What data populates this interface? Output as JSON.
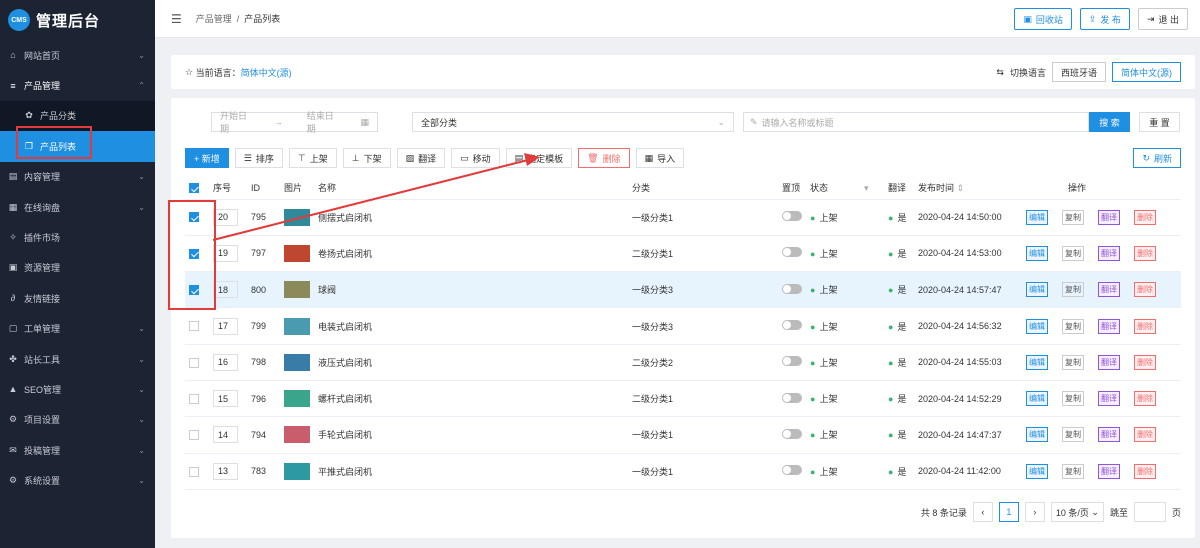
{
  "brand": {
    "badge": "CMS",
    "title": "管理后台"
  },
  "nav": [
    {
      "label": "网站首页",
      "icon": "⌂"
    },
    {
      "label": "产品管理",
      "icon": "≡"
    },
    {
      "label": "产品分类",
      "icon": "✿"
    },
    {
      "label": "产品列表",
      "icon": "❐"
    },
    {
      "label": "内容管理",
      "icon": "▤"
    },
    {
      "label": "在线询盘",
      "icon": "▦"
    },
    {
      "label": "插件市场",
      "icon": "✧"
    },
    {
      "label": "资源管理",
      "icon": "▣"
    },
    {
      "label": "友情链接",
      "icon": "∂"
    },
    {
      "label": "工单管理",
      "icon": "▢"
    },
    {
      "label": "站长工具",
      "icon": "✤"
    },
    {
      "label": "SEO管理",
      "icon": "▲"
    },
    {
      "label": "项目设置",
      "icon": "⚙"
    },
    {
      "label": "投稿管理",
      "icon": "✉"
    },
    {
      "label": "系统设置",
      "icon": "⚙"
    }
  ],
  "breadcrumb": {
    "parent": "产品管理",
    "sep": "/",
    "current": "产品列表"
  },
  "top": {
    "recycle": "回收站",
    "publish": "发 布",
    "logout": "退 出"
  },
  "lang": {
    "label": "当前语言：",
    "current": "简体中文(源)",
    "switch": "切换语言",
    "opt1": "西班牙语",
    "opt2": "简体中文(源)"
  },
  "filter": {
    "start": "开始日期",
    "arrow": "→",
    "end": "结束日期",
    "category": "全部分类",
    "search_ph": "请输入名称或标题",
    "search": "搜 索",
    "reset": "重 置"
  },
  "toolbar": {
    "add": "+ 新增",
    "sort": "排序",
    "up": "上架",
    "down": "下架",
    "translate": "翻译",
    "move": "移动",
    "template": "指定模板",
    "del": "删除",
    "import": "导入",
    "refresh": "刷新"
  },
  "headers": {
    "sort": "序号",
    "id": "ID",
    "img": "图片",
    "name": "名称",
    "cat": "分类",
    "top": "置顶",
    "status": "状态",
    "tr": "翻译",
    "time": "发布时间",
    "ops": "操作"
  },
  "actions": {
    "edit": "编辑",
    "copy": "复制",
    "translate": "翻译",
    "delete": "删除"
  },
  "rows": [
    {
      "checked": true,
      "sort": "20",
      "id": "795",
      "name": "侧摆式启闭机",
      "cat": "一级分类1",
      "status": "上架",
      "tr": "是",
      "time": "2020-04-24 14:50:00",
      "color": "#2f8a9c"
    },
    {
      "checked": true,
      "sort": "19",
      "id": "797",
      "name": "卷扬式启闭机",
      "cat": "二级分类1",
      "status": "上架",
      "tr": "是",
      "time": "2020-04-24 14:53:00",
      "color": "#c0472f"
    },
    {
      "checked": true,
      "sort": "18",
      "id": "800",
      "name": "球阀",
      "cat": "一级分类3",
      "status": "上架",
      "tr": "是",
      "time": "2020-04-24 14:57:47",
      "color": "#8a8a5a"
    },
    {
      "checked": false,
      "sort": "17",
      "id": "799",
      "name": "电装式启闭机",
      "cat": "一级分类3",
      "status": "上架",
      "tr": "是",
      "time": "2020-04-24 14:56:32",
      "color": "#4a9ab0"
    },
    {
      "checked": false,
      "sort": "16",
      "id": "798",
      "name": "液压式启闭机",
      "cat": "二级分类2",
      "status": "上架",
      "tr": "是",
      "time": "2020-04-24 14:55:03",
      "color": "#3a7ca8"
    },
    {
      "checked": false,
      "sort": "15",
      "id": "796",
      "name": "螺杆式启闭机",
      "cat": "二级分类1",
      "status": "上架",
      "tr": "是",
      "time": "2020-04-24 14:52:29",
      "color": "#3aa58a"
    },
    {
      "checked": false,
      "sort": "14",
      "id": "794",
      "name": "手轮式启闭机",
      "cat": "一级分类1",
      "status": "上架",
      "tr": "是",
      "time": "2020-04-24 14:47:37",
      "color": "#c95d6b"
    },
    {
      "checked": false,
      "sort": "13",
      "id": "783",
      "name": "平推式启闭机",
      "cat": "一级分类1",
      "status": "上架",
      "tr": "是",
      "time": "2020-04-24 11:42:00",
      "color": "#2c9aa0"
    }
  ],
  "pager": {
    "total": "共 8 条记录",
    "prev": "‹",
    "page": "1",
    "next": "›",
    "size": "10 条/页",
    "goto": "跳至",
    "unit": "页"
  }
}
